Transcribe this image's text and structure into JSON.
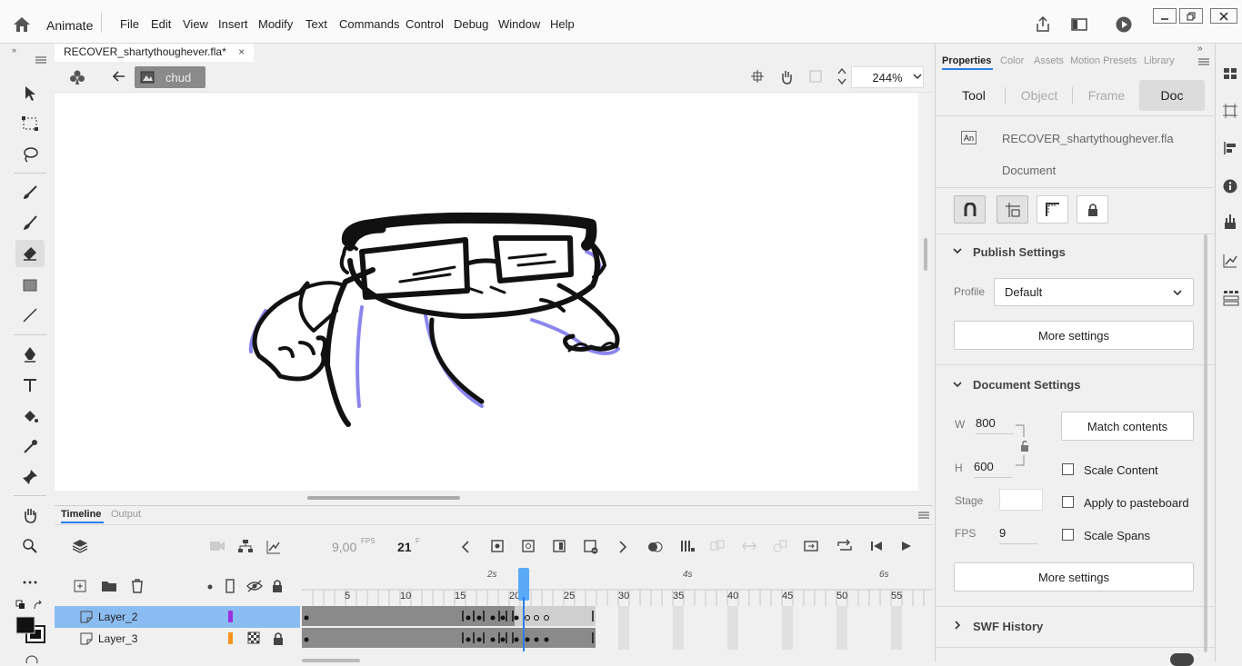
{
  "menubar": {
    "app_name": "Animate",
    "items": [
      "File",
      "Edit",
      "View",
      "Insert",
      "Modify",
      "Text",
      "Commands",
      "Control",
      "Debug",
      "Window",
      "Help"
    ]
  },
  "document": {
    "tab_title": "RECOVER_shartythoughever.fla*",
    "breadcrumb": "chud",
    "zoom": "244%"
  },
  "timeline": {
    "tabs": [
      "Timeline",
      "Output"
    ],
    "fps": "9,00",
    "fps_unit": "FPS",
    "current_frame": "21",
    "frame_unit": "F",
    "time_markers": [
      "2s",
      "4s",
      "6s"
    ],
    "frame_numbers": [
      "5",
      "10",
      "15",
      "20",
      "25",
      "30",
      "35",
      "40",
      "45",
      "50",
      "55"
    ],
    "layers": [
      {
        "name": "Layer_2",
        "color": "#9b30e0"
      },
      {
        "name": "Layer_3",
        "color": "#f7931e"
      }
    ]
  },
  "properties": {
    "tabs": [
      "Properties",
      "Color",
      "Assets",
      "Motion Presets",
      "Library"
    ],
    "sub_tabs": [
      "Tool",
      "Object",
      "Frame",
      "Doc"
    ],
    "doc_name": "RECOVER_shartythoughever.fla",
    "doc_type": "Document",
    "doc_icon_text": "An",
    "publish": {
      "title": "Publish Settings",
      "profile_label": "Profile",
      "profile_value": "Default",
      "more_settings": "More settings"
    },
    "document_settings": {
      "title": "Document Settings",
      "w_label": "W",
      "w_value": "800",
      "h_label": "H",
      "h_value": "600",
      "match_contents": "Match contents",
      "scale_content": "Scale Content",
      "stage_label": "Stage",
      "apply_to_pasteboard": "Apply to pasteboard",
      "fps_label": "FPS",
      "fps_value": "9",
      "scale_spans": "Scale Spans",
      "more_settings": "More settings"
    },
    "swf_history": "SWF History"
  },
  "colors": {
    "accent": "#2b7de9",
    "layer_selected": "#8bbcf1",
    "playhead": "#5aa9f7",
    "frame_fill": "#8a8a8a",
    "outline_purple": "#8b86ee"
  }
}
